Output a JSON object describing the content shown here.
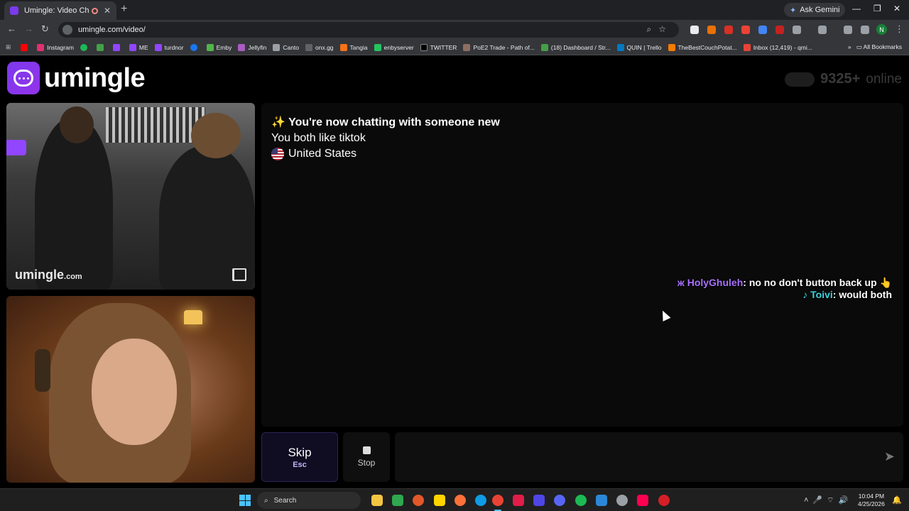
{
  "browser": {
    "tab_title": "Umingle: Video Chat with S",
    "ask_gemini": "Ask Gemini",
    "url": "umingle.com/video/",
    "bookmarks": [
      "Instagram",
      "ME",
      "turdnor",
      "Emby",
      "Jellyfin",
      "Canto",
      "onx.gg",
      "Tangia",
      "enbyserver",
      "TWITTER",
      "PoE2 Trade - Path of...",
      "(18) Dashboard / Str...",
      "QUIN | Trello",
      "TheBestCouchPotat...",
      "Inbox (12,419) - qmi..."
    ],
    "all_bookmarks": "All Bookmarks",
    "profile_initial": "N"
  },
  "page": {
    "logo_text": "umingle",
    "online_count": "9325+",
    "online_label": "online",
    "watermark": "umingle",
    "watermark_suffix": ".com"
  },
  "chat": {
    "system_new": "You're now chatting with someone new",
    "common_interest": "You both like tiktok",
    "country": "United States",
    "overlay_messages": [
      {
        "user": "HolyGhuleh",
        "text": ": no no don't button back up"
      },
      {
        "user": "Toivi",
        "text": ": would both"
      }
    ]
  },
  "controls": {
    "skip_label": "Skip",
    "skip_key": "Esc",
    "stop_label": "Stop",
    "message_placeholder": ""
  },
  "taskbar": {
    "search_label": "Search",
    "time": "10:04 PM",
    "date": "4/25/2026"
  },
  "colors": {
    "brand": "#7c3aed",
    "skip_bg": "#100c22"
  }
}
